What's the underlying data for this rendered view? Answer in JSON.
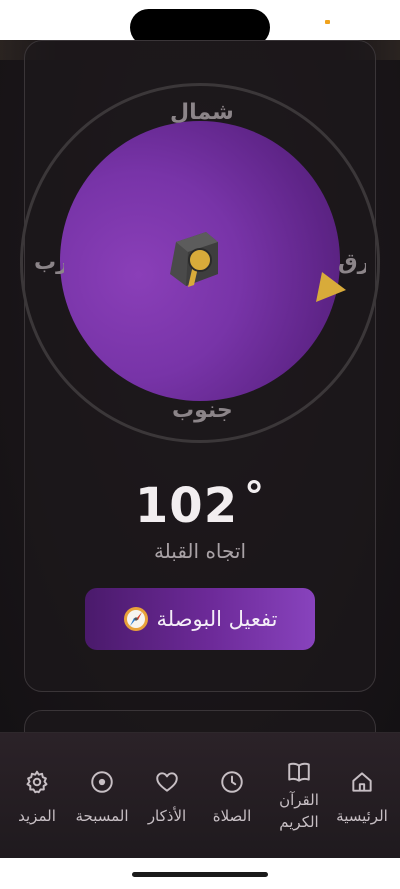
{
  "compass": {
    "north": "شمال",
    "south": "جنوب",
    "east": "شرق",
    "west": "غرب"
  },
  "qibla": {
    "degrees": "102",
    "degree_symbol": "°",
    "caption": "اتجاه القبلة",
    "activate_label": "تفعيل البوصلة",
    "activate_icon": "compass-emoji-icon"
  },
  "nav": {
    "items": [
      {
        "label": "الرئيسية",
        "icon": "home-icon"
      },
      {
        "label": "القرآن الكريم",
        "icon": "book-icon"
      },
      {
        "label": "الصلاة",
        "icon": "clock-icon"
      },
      {
        "label": "الأذكار",
        "icon": "heart-icon"
      },
      {
        "label": "المسبحة",
        "icon": "target-circle-icon"
      },
      {
        "label": "المزيد",
        "icon": "gear-icon"
      }
    ]
  },
  "colors": {
    "accent_purple": "#7834a8",
    "accent_gold": "#d8ab3a",
    "background": "#1f1a1e"
  }
}
